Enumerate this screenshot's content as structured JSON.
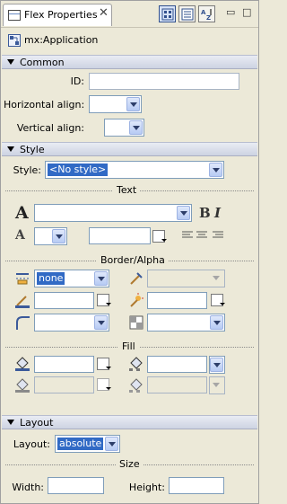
{
  "tab": {
    "title": "Flex Properties",
    "close": "✕"
  },
  "toolbar": {
    "min": "▭",
    "max": "□"
  },
  "component": {
    "name": "mx:Application"
  },
  "common": {
    "header": "Common",
    "id_label": "ID:",
    "id_value": "",
    "halign_label": "Horizontal align:",
    "halign_value": "",
    "valign_label": "Vertical align:",
    "valign_value": ""
  },
  "style": {
    "header": "Style",
    "style_label": "Style:",
    "style_value": "<No style>",
    "text_group": "Text",
    "font_family_value": "",
    "font_size_value": "",
    "text_color_value": "",
    "bold": "B",
    "italic": "I",
    "border_group": "Border/Alpha",
    "border_style_value": "none",
    "border_thickness_value": "",
    "border_color_value": "",
    "corner_color_value": "",
    "corner_radius_value": "",
    "alpha_value": "",
    "fill_group": "Fill",
    "fill_color_value": "",
    "fill_alpha_value": "",
    "fill_color2_value": "",
    "fill_alpha2_value": ""
  },
  "layout": {
    "header": "Layout",
    "layout_label": "Layout:",
    "layout_value": "absolute",
    "size_group": "Size",
    "width_label": "Width:",
    "width_value": "",
    "height_label": "Height:",
    "height_value": ""
  }
}
